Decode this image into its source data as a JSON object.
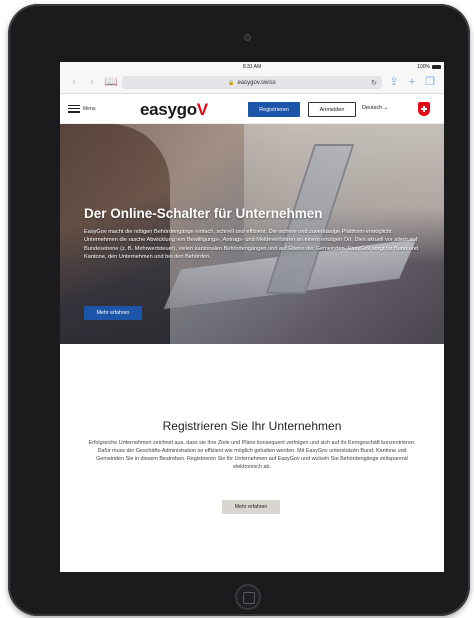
{
  "status_bar": {
    "time": "8:31 AM",
    "battery": "100%"
  },
  "browser": {
    "url": "easygov.swiss",
    "icons": [
      "back-icon",
      "forward-icon",
      "bookmarks-icon",
      "lock-icon",
      "reload-icon",
      "share-icon",
      "new-tab-icon",
      "tabs-icon"
    ]
  },
  "site_header": {
    "menu_label": "Menu",
    "logo_text": "easygo",
    "logo_accent": "V",
    "register_label": "Registrieren",
    "login_label": "Anmelden",
    "language": "Deutsch",
    "colors": {
      "primary": "#1d55a8",
      "accent": "#e30613"
    }
  },
  "hero": {
    "title": "Der Online-Schalter für Unternehmen",
    "text": "EasyGov macht die nötigen Behördengänge einfach, schnell und effizient. Die sichere und zuverlässige Plattform ermöglicht Unternehmen die rasche Abwicklung von Bewilligungs-, Antrags- und Meldeverfahren an einem einzigen Ort. Dies aktuell vor allem auf Bundesebene (z. B. Mehrwertsteuer), vielen kantonalen Behördengängen und auf Ebene der Gemeinden. EasyGov sorgt für Bund und Kantone, den Unternehmen und bei den Behörden.",
    "button_label": "Mehr erfahren"
  },
  "register": {
    "title": "Registrieren Sie Ihr Unternehmen",
    "text": "Erfolgreiche Unternehmen zeichnet aus, dass sie ihre Ziele und Pläne konsequent verfolgen und sich auf ihr Kerngeschäft konzentrieren. Dafür muss der Geschäfts-Administration so effizient wie möglich gehalten werden. Mit EasyGov unterstützen Bund, Kantone und Gemeinden Sie in diesem Bestreben. Registrieren Sie Ihr Unternehmen auf EasyGov und wickeln Sie Behördengänge zeitsparend elektronisch ab.",
    "button_label": "Mehr erfahren"
  }
}
